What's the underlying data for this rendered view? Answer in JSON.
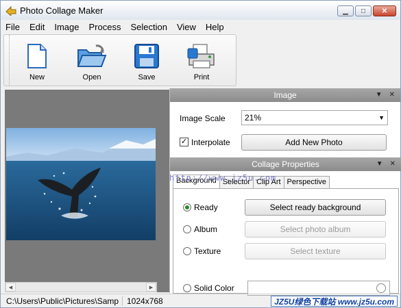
{
  "window": {
    "title": "Photo Collage Maker"
  },
  "menu": [
    "File",
    "Edit",
    "Image",
    "Process",
    "Selection",
    "View",
    "Help"
  ],
  "toolbar": {
    "new_label": "New",
    "open_label": "Open",
    "save_label": "Save",
    "print_label": "Print"
  },
  "statusbar": {
    "path": "C:\\Users\\Public\\Pictures\\Samp",
    "size": "1024x768",
    "watermark": "JZ5U绿色下载站 www.jz5u.com"
  },
  "image_panel": {
    "title": "Image",
    "scale_label": "Image Scale",
    "scale_value": "21%",
    "interpolate_label": "Interpolate",
    "interpolate_checked": true,
    "add_photo_label": "Add New Photo"
  },
  "collage_panel": {
    "title": "Collage Properties",
    "url_overlay": "http://www.jz5u.com",
    "tabs": [
      "Background",
      "Selector",
      "Clip Art",
      "Perspective"
    ],
    "options": {
      "ready_label": "Ready",
      "ready_button": "Select ready background",
      "album_label": "Album",
      "album_button": "Select photo album",
      "texture_label": "Texture",
      "texture_button": "Select texture",
      "solid_label": "Solid Color"
    }
  },
  "colors": {
    "panel_header": "#999999",
    "accent": "#2a8a2a"
  }
}
